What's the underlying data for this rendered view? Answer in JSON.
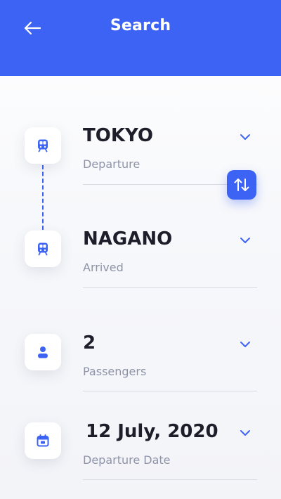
{
  "colors": {
    "accent": "#3d63f4",
    "text": "#1e1e2a",
    "muted": "#8e93a8"
  },
  "header": {
    "title": "Search",
    "back_icon": "arrow-left-icon"
  },
  "departure": {
    "value": "TOKYO",
    "label": "Departure",
    "icon": "train-icon"
  },
  "arrival": {
    "value": "NAGANO",
    "label": "Arrived",
    "icon": "train-icon"
  },
  "swap": {
    "icon": "swap-vertical-icon"
  },
  "passengers": {
    "value": "2",
    "label": "Passengers",
    "icon": "person-icon"
  },
  "date": {
    "value": "12 July, 2020",
    "label": "Departure Date",
    "icon": "calendar-icon"
  }
}
